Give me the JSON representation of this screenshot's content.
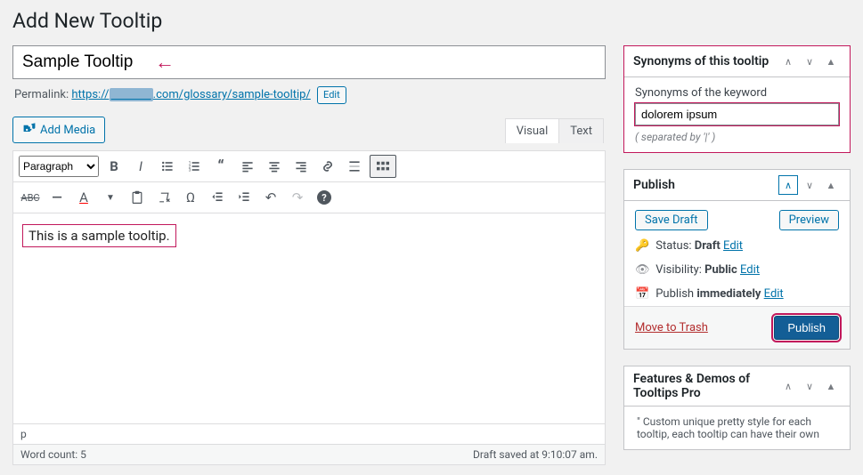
{
  "page_title": "Add New Tooltip",
  "title_value": "Sample Tooltip",
  "permalink": {
    "label": "Permalink:",
    "prefix": "https://",
    "suffix": ".com/glossary/sample-tooltip/",
    "edit": "Edit"
  },
  "media_btn": "Add Media",
  "tabs": {
    "visual": "Visual",
    "text": "Text"
  },
  "paragraph_option": "Paragraph",
  "content_text": "This is a sample tooltip.",
  "status_p": "p",
  "word_count": "Word count: 5",
  "draft_saved": "Draft saved at 9:10:07 am.",
  "sidebars": {
    "synonyms": {
      "heading": "Synonyms of this tooltip",
      "label": "Synonyms of the keyword",
      "value": "dolorem ipsum",
      "hint": "( separated by '|' )"
    },
    "publish": {
      "heading": "Publish",
      "save": "Save Draft",
      "preview": "Preview",
      "status_label": "Status:",
      "status_value": "Draft",
      "visibility_label": "Visibility:",
      "visibility_value": "Public",
      "schedule_label": "Publish",
      "schedule_value": "immediately",
      "edit": "Edit",
      "trash": "Move to Trash",
      "publish_btn": "Publish"
    },
    "features": {
      "heading": "Features & Demos of Tooltips Pro",
      "text": "\" Custom unique pretty style for each tooltip, each tooltip can have their own"
    }
  }
}
